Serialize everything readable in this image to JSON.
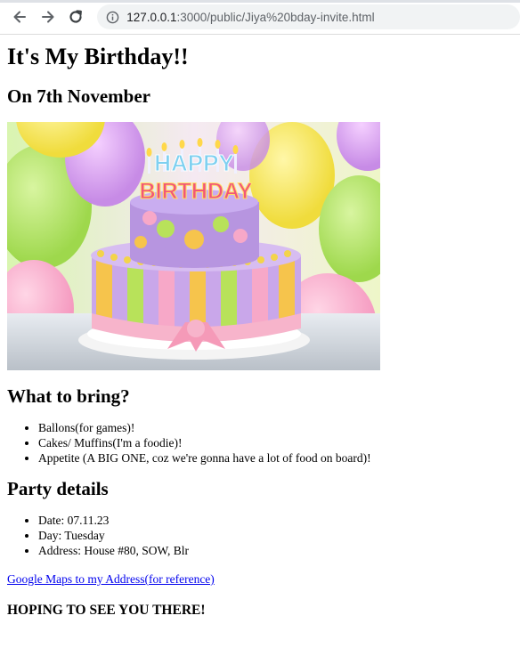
{
  "browser": {
    "url_host": "127.0.0.1",
    "url_path": ":3000/public/Jiya%20bday-invite.html"
  },
  "page": {
    "title": "It's My Birthday!!",
    "subtitle": "On 7th November",
    "what_to_bring": {
      "heading": "What to bring?",
      "items": [
        "Ballons(for games)!",
        "Cakes/ Muffins(I'm a foodie)!",
        "Appetite (A BIG ONE, coz we're gonna have a lot of food on board)!"
      ]
    },
    "party_details": {
      "heading": "Party details",
      "items": [
        "Date: 07.11.23",
        "Day: Tuesday",
        "Address: House #80, SOW, Blr"
      ]
    },
    "maps_link": "Google Maps to my Address(for reference)",
    "closing": "HOPING TO SEE YOU THERE!",
    "cake_text_line1": "HAPPY",
    "cake_text_line2": "BIRTHDAY"
  }
}
